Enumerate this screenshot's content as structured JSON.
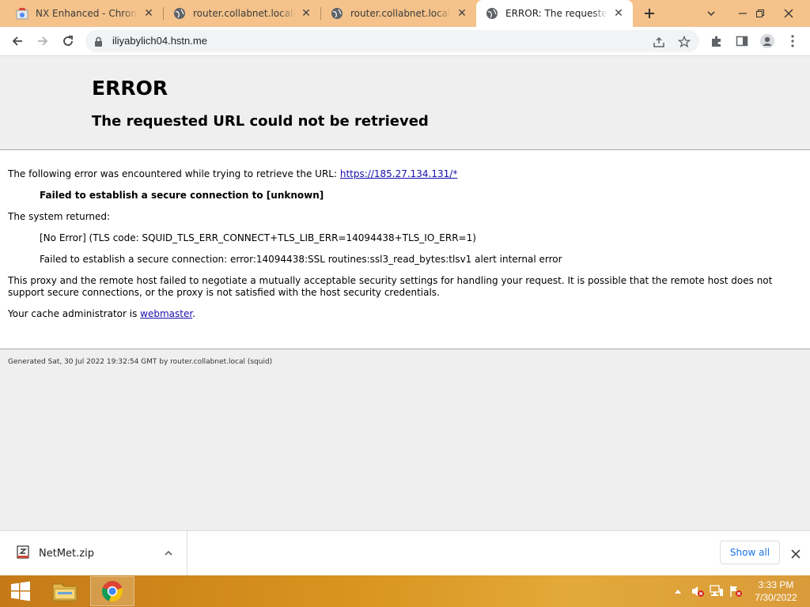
{
  "browser": {
    "tabs": [
      {
        "title": "NX Enhanced - Chrome Web Store",
        "icon": "chrome-web-store-icon",
        "active": false
      },
      {
        "title": "router.collabnet.local/blocked",
        "icon": "globe-icon",
        "active": false
      },
      {
        "title": "router.collabnet.local/blocked",
        "icon": "globe-icon",
        "active": false
      },
      {
        "title": "ERROR: The requested URL could not be retrieved",
        "icon": "globe-icon",
        "active": true
      }
    ],
    "url": "iliyabylich04.hstn.me"
  },
  "page": {
    "heading": "ERROR",
    "subheading": "The requested URL could not be retrieved",
    "intro_text": "The following error was encountered while trying to retrieve the URL: ",
    "intro_link": "https://185.27.134.131/*",
    "error_title": "Failed to establish a secure connection to [unknown]",
    "system_returned": "The system returned:",
    "detail_1": "[No Error] (TLS code: SQUID_TLS_ERR_CONNECT+TLS_LIB_ERR=14094438+TLS_IO_ERR=1)",
    "detail_2": "Failed to establish a secure connection: error:14094438:SSL routines:ssl3_read_bytes:tlsv1 alert internal error",
    "explanation": "This proxy and the remote host failed to negotiate a mutually acceptable security settings for handling your request. It is possible that the remote host does not support secure connections, or the proxy is not satisfied with the host security credentials.",
    "admin_prefix": "Your cache administrator is ",
    "admin_link": "webmaster",
    "admin_suffix": ".",
    "footer": "Generated Sat, 30 Jul 2022 19:32:54 GMT by router.collabnet.local (squid)"
  },
  "downloads": {
    "file_name": "NetMet.zip",
    "show_all_label": "Show all"
  },
  "taskbar": {
    "time": "3:33 PM",
    "date": "7/30/2022"
  },
  "colors": {
    "tabstrip": "#f4c28a",
    "link": "#1a0dab",
    "show_all": "#1a73e8"
  }
}
